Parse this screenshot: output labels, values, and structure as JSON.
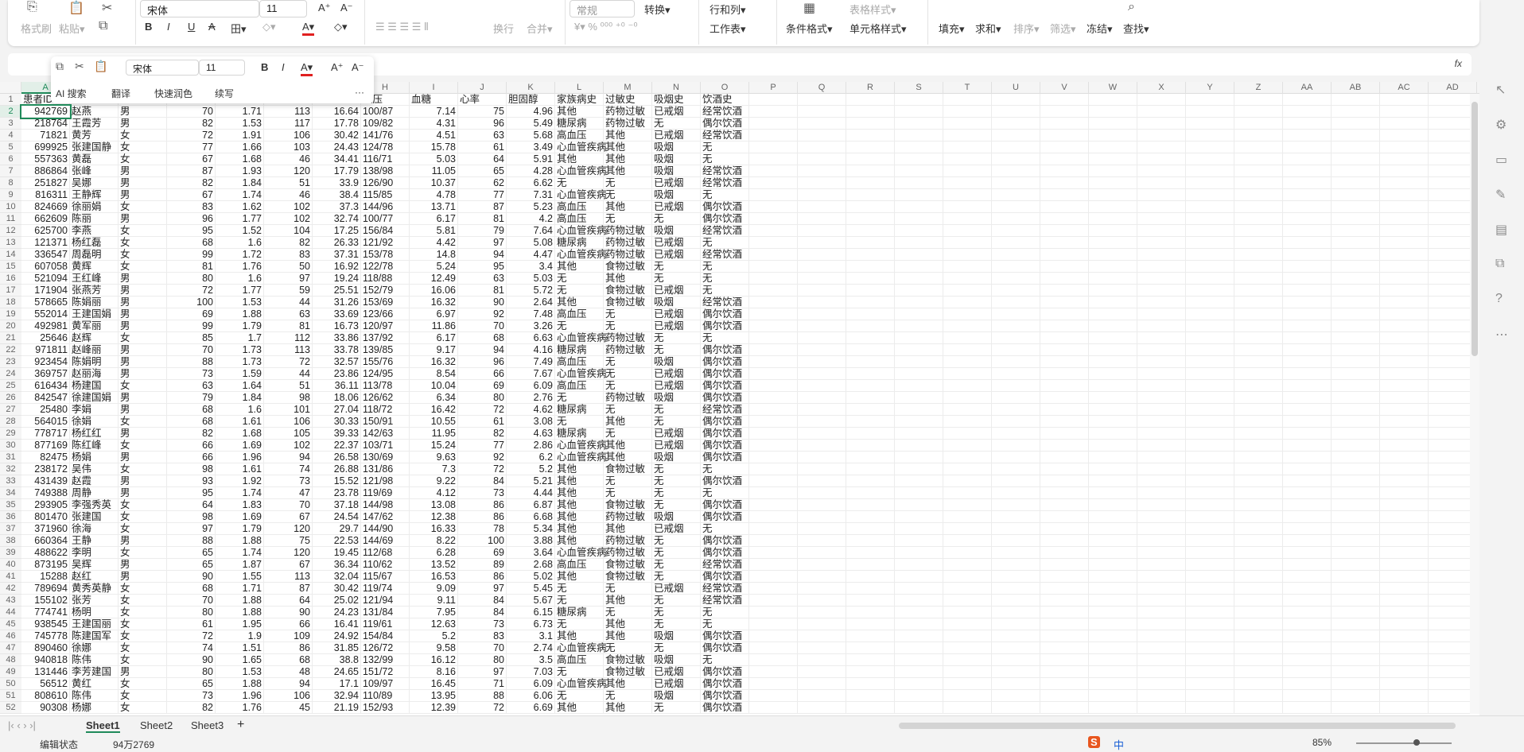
{
  "ribbon": {
    "row2": [
      "格式刷",
      "粘贴▾"
    ],
    "font": "宋体",
    "size": "11",
    "wrap": "换行",
    "merge": "合并▾",
    "number_format": "常规",
    "convert": "转换▾",
    "rows_cols": "行和列▾",
    "worksheet": "工作表▾",
    "cond_format": "条件格式▾",
    "table_style": "表格样式▾",
    "cell_style": "单元格样式▾",
    "fill": "填充▾",
    "sum": "求和▾",
    "sort": "排序▾",
    "filter": "筛选▾",
    "freeze": "冻结▾",
    "find": "查找▾",
    "accent": "#e02020"
  },
  "formula_bar": {
    "fx": "fx"
  },
  "mini_toolbar": {
    "font": "宋体",
    "size": "11",
    "ai_search": "AI 搜索",
    "translate": "翻译",
    "polish": "快速润色",
    "continue": "续写",
    "more": "···"
  },
  "columns": [
    "A",
    "B",
    "C",
    "D",
    "E",
    "F",
    "G",
    "H",
    "I",
    "J",
    "K",
    "L",
    "M",
    "N",
    "O",
    "P",
    "Q",
    "R",
    "S",
    "T",
    "U",
    "V",
    "W",
    "X",
    "Y",
    "Z",
    "AA",
    "AB",
    "AC",
    "AD"
  ],
  "header_row": [
    "患者ID",
    "",
    "",
    "",
    "",
    "",
    "",
    "血压",
    "血糖",
    "心率",
    "胆固醇",
    "家族病史",
    "过敏史",
    "吸烟史",
    "饮酒史"
  ],
  "rows": [
    [
      "942769",
      "赵燕",
      "男",
      "70",
      "1.71",
      "113",
      "16.64",
      "100/87",
      "7.14",
      "75",
      "4.96",
      "其他",
      "药物过敏",
      "已戒烟",
      "经常饮酒"
    ],
    [
      "218764",
      "王霞芳",
      "男",
      "82",
      "1.53",
      "117",
      "17.78",
      "109/82",
      "4.31",
      "96",
      "5.49",
      "糖尿病",
      "药物过敏",
      "无",
      "偶尔饮酒"
    ],
    [
      "71821",
      "黄芳",
      "女",
      "72",
      "1.91",
      "106",
      "30.42",
      "141/76",
      "4.51",
      "63",
      "5.68",
      "高血压",
      "其他",
      "已戒烟",
      "经常饮酒"
    ],
    [
      "699925",
      "张建国静",
      "女",
      "77",
      "1.66",
      "103",
      "24.43",
      "124/78",
      "15.78",
      "61",
      "3.49",
      "心血管疾病",
      "其他",
      "吸烟",
      "无"
    ],
    [
      "557363",
      "黄磊",
      "女",
      "67",
      "1.68",
      "46",
      "34.41",
      "116/71",
      "5.03",
      "64",
      "5.91",
      "其他",
      "其他",
      "吸烟",
      "无"
    ],
    [
      "886864",
      "张峰",
      "男",
      "87",
      "1.93",
      "120",
      "17.79",
      "138/98",
      "11.05",
      "65",
      "4.28",
      "心血管疾病",
      "其他",
      "吸烟",
      "经常饮酒"
    ],
    [
      "251827",
      "吴娜",
      "男",
      "82",
      "1.84",
      "51",
      "33.9",
      "126/90",
      "10.37",
      "62",
      "6.62",
      "无",
      "无",
      "已戒烟",
      "经常饮酒"
    ],
    [
      "816311",
      "王静辉",
      "男",
      "67",
      "1.74",
      "46",
      "38.4",
      "115/85",
      "4.78",
      "77",
      "7.31",
      "心血管疾病",
      "无",
      "吸烟",
      "无"
    ],
    [
      "824669",
      "徐丽娟",
      "女",
      "83",
      "1.62",
      "102",
      "37.3",
      "144/96",
      "13.71",
      "87",
      "5.23",
      "高血压",
      "其他",
      "已戒烟",
      "偶尔饮酒"
    ],
    [
      "662609",
      "陈丽",
      "男",
      "96",
      "1.77",
      "102",
      "32.74",
      "100/77",
      "6.17",
      "81",
      "4.2",
      "高血压",
      "无",
      "无",
      "偶尔饮酒"
    ],
    [
      "625700",
      "李燕",
      "女",
      "95",
      "1.52",
      "104",
      "17.25",
      "156/84",
      "5.81",
      "79",
      "7.64",
      "心血管疾病",
      "药物过敏",
      "吸烟",
      "经常饮酒"
    ],
    [
      "121371",
      "杨红磊",
      "女",
      "68",
      "1.6",
      "82",
      "26.33",
      "121/92",
      "4.42",
      "97",
      "5.08",
      "糖尿病",
      "药物过敏",
      "已戒烟",
      "无"
    ],
    [
      "336547",
      "周磊明",
      "女",
      "99",
      "1.72",
      "83",
      "37.31",
      "153/78",
      "14.8",
      "94",
      "4.47",
      "心血管疾病",
      "药物过敏",
      "已戒烟",
      "经常饮酒"
    ],
    [
      "607058",
      "黄辉",
      "女",
      "81",
      "1.76",
      "50",
      "16.92",
      "122/78",
      "5.24",
      "95",
      "3.4",
      "其他",
      "食物过敏",
      "无",
      "无"
    ],
    [
      "521094",
      "王红峰",
      "男",
      "80",
      "1.6",
      "97",
      "19.24",
      "118/88",
      "12.49",
      "63",
      "5.03",
      "无",
      "其他",
      "无",
      "无"
    ],
    [
      "171904",
      "张燕芳",
      "男",
      "72",
      "1.77",
      "59",
      "25.51",
      "152/79",
      "16.06",
      "81",
      "5.72",
      "无",
      "食物过敏",
      "已戒烟",
      "无"
    ],
    [
      "578665",
      "陈娟丽",
      "男",
      "100",
      "1.53",
      "44",
      "31.26",
      "153/69",
      "16.32",
      "90",
      "2.64",
      "其他",
      "食物过敏",
      "吸烟",
      "经常饮酒"
    ],
    [
      "552014",
      "王建国娟",
      "男",
      "69",
      "1.88",
      "63",
      "33.69",
      "123/66",
      "6.97",
      "92",
      "7.48",
      "高血压",
      "无",
      "已戒烟",
      "偶尔饮酒"
    ],
    [
      "492981",
      "黄军丽",
      "男",
      "99",
      "1.79",
      "81",
      "16.73",
      "120/97",
      "11.86",
      "70",
      "3.26",
      "无",
      "无",
      "已戒烟",
      "偶尔饮酒"
    ],
    [
      "25646",
      "赵辉",
      "女",
      "85",
      "1.7",
      "112",
      "33.86",
      "137/92",
      "6.17",
      "68",
      "6.63",
      "心血管疾病",
      "药物过敏",
      "无",
      "无"
    ],
    [
      "971811",
      "赵峰丽",
      "男",
      "70",
      "1.73",
      "113",
      "33.78",
      "139/85",
      "9.17",
      "94",
      "4.16",
      "糖尿病",
      "药物过敏",
      "无",
      "偶尔饮酒"
    ],
    [
      "923454",
      "陈娟明",
      "男",
      "88",
      "1.73",
      "72",
      "32.57",
      "155/76",
      "16.32",
      "96",
      "7.49",
      "高血压",
      "无",
      "吸烟",
      "偶尔饮酒"
    ],
    [
      "369757",
      "赵丽海",
      "男",
      "73",
      "1.59",
      "44",
      "23.86",
      "124/95",
      "8.54",
      "66",
      "7.67",
      "心血管疾病",
      "无",
      "已戒烟",
      "偶尔饮酒"
    ],
    [
      "616434",
      "杨建国",
      "女",
      "63",
      "1.64",
      "51",
      "36.11",
      "113/78",
      "10.04",
      "69",
      "6.09",
      "高血压",
      "无",
      "已戒烟",
      "偶尔饮酒"
    ],
    [
      "842547",
      "徐建国娟",
      "男",
      "79",
      "1.84",
      "98",
      "18.06",
      "126/62",
      "6.34",
      "80",
      "2.76",
      "无",
      "药物过敏",
      "吸烟",
      "偶尔饮酒"
    ],
    [
      "25480",
      "李娟",
      "男",
      "68",
      "1.6",
      "101",
      "27.04",
      "118/72",
      "16.42",
      "72",
      "4.62",
      "糖尿病",
      "无",
      "无",
      "经常饮酒"
    ],
    [
      "564015",
      "徐娟",
      "女",
      "68",
      "1.61",
      "106",
      "30.33",
      "150/91",
      "10.55",
      "61",
      "3.08",
      "无",
      "其他",
      "无",
      "偶尔饮酒"
    ],
    [
      "778717",
      "杨红红",
      "男",
      "82",
      "1.68",
      "105",
      "39.33",
      "142/63",
      "11.95",
      "82",
      "4.63",
      "糖尿病",
      "无",
      "已戒烟",
      "偶尔饮酒"
    ],
    [
      "877169",
      "陈红峰",
      "女",
      "66",
      "1.69",
      "102",
      "22.37",
      "103/71",
      "15.24",
      "77",
      "2.86",
      "心血管疾病",
      "其他",
      "已戒烟",
      "偶尔饮酒"
    ],
    [
      "82475",
      "杨娟",
      "男",
      "66",
      "1.96",
      "94",
      "26.58",
      "130/69",
      "9.63",
      "92",
      "6.2",
      "心血管疾病",
      "其他",
      "吸烟",
      "偶尔饮酒"
    ],
    [
      "238172",
      "吴伟",
      "女",
      "98",
      "1.61",
      "74",
      "26.88",
      "131/86",
      "7.3",
      "72",
      "5.2",
      "其他",
      "食物过敏",
      "无",
      "无"
    ],
    [
      "431439",
      "赵霞",
      "男",
      "93",
      "1.92",
      "73",
      "15.52",
      "121/98",
      "9.22",
      "84",
      "5.21",
      "其他",
      "无",
      "无",
      "偶尔饮酒"
    ],
    [
      "749388",
      "周静",
      "男",
      "95",
      "1.74",
      "47",
      "23.78",
      "119/69",
      "4.12",
      "73",
      "4.44",
      "其他",
      "无",
      "无",
      "无"
    ],
    [
      "293905",
      "李强秀英",
      "女",
      "64",
      "1.83",
      "70",
      "37.18",
      "144/98",
      "13.08",
      "86",
      "6.87",
      "其他",
      "食物过敏",
      "无",
      "偶尔饮酒"
    ],
    [
      "801470",
      "张建国",
      "女",
      "98",
      "1.69",
      "67",
      "24.54",
      "147/62",
      "12.38",
      "86",
      "6.68",
      "其他",
      "药物过敏",
      "吸烟",
      "偶尔饮酒"
    ],
    [
      "371960",
      "徐海",
      "女",
      "97",
      "1.79",
      "120",
      "29.7",
      "144/90",
      "16.33",
      "78",
      "5.34",
      "其他",
      "其他",
      "已戒烟",
      "无"
    ],
    [
      "660364",
      "王静",
      "男",
      "88",
      "1.88",
      "75",
      "22.53",
      "144/69",
      "8.22",
      "100",
      "3.88",
      "其他",
      "药物过敏",
      "无",
      "偶尔饮酒"
    ],
    [
      "488622",
      "李明",
      "女",
      "65",
      "1.74",
      "120",
      "19.45",
      "112/68",
      "6.28",
      "69",
      "3.64",
      "心血管疾病",
      "药物过敏",
      "无",
      "偶尔饮酒"
    ],
    [
      "873195",
      "吴辉",
      "男",
      "65",
      "1.87",
      "67",
      "36.34",
      "110/62",
      "13.52",
      "89",
      "2.68",
      "高血压",
      "食物过敏",
      "无",
      "经常饮酒"
    ],
    [
      "15288",
      "赵红",
      "男",
      "90",
      "1.55",
      "113",
      "32.04",
      "115/67",
      "16.53",
      "86",
      "5.02",
      "其他",
      "食物过敏",
      "无",
      "偶尔饮酒"
    ],
    [
      "789694",
      "黄秀英静",
      "女",
      "68",
      "1.71",
      "87",
      "30.42",
      "119/74",
      "9.09",
      "97",
      "5.45",
      "无",
      "无",
      "已戒烟",
      "经常饮酒"
    ],
    [
      "155102",
      "张芳",
      "女",
      "70",
      "1.88",
      "64",
      "25.02",
      "121/94",
      "9.11",
      "84",
      "5.67",
      "无",
      "其他",
      "无",
      "经常饮酒"
    ],
    [
      "774741",
      "杨明",
      "女",
      "80",
      "1.88",
      "90",
      "24.23",
      "131/84",
      "7.95",
      "84",
      "6.15",
      "糖尿病",
      "无",
      "无",
      "无"
    ],
    [
      "938545",
      "王建国丽",
      "女",
      "61",
      "1.95",
      "66",
      "16.41",
      "119/61",
      "12.63",
      "73",
      "6.73",
      "无",
      "其他",
      "无",
      "无"
    ],
    [
      "745778",
      "陈建国军",
      "女",
      "72",
      "1.9",
      "109",
      "24.92",
      "154/84",
      "5.2",
      "83",
      "3.1",
      "其他",
      "其他",
      "吸烟",
      "偶尔饮酒"
    ],
    [
      "890460",
      "徐娜",
      "女",
      "74",
      "1.51",
      "86",
      "31.85",
      "126/72",
      "9.58",
      "70",
      "2.74",
      "心血管疾病",
      "无",
      "无",
      "偶尔饮酒"
    ],
    [
      "940818",
      "陈伟",
      "女",
      "90",
      "1.65",
      "68",
      "38.8",
      "132/99",
      "16.12",
      "80",
      "3.5",
      "高血压",
      "食物过敏",
      "吸烟",
      "无"
    ],
    [
      "131446",
      "李芳建国",
      "男",
      "80",
      "1.53",
      "48",
      "24.65",
      "151/72",
      "8.16",
      "97",
      "7.03",
      "无",
      "食物过敏",
      "已戒烟",
      "偶尔饮酒"
    ],
    [
      "56512",
      "黄红",
      "女",
      "65",
      "1.88",
      "94",
      "17.1",
      "109/97",
      "16.45",
      "71",
      "6.09",
      "心血管疾病",
      "其他",
      "已戒烟",
      "偶尔饮酒"
    ],
    [
      "808610",
      "陈伟",
      "女",
      "73",
      "1.96",
      "106",
      "32.94",
      "110/89",
      "13.95",
      "88",
      "6.06",
      "无",
      "无",
      "吸烟",
      "偶尔饮酒"
    ],
    [
      "90308",
      "杨娜",
      "女",
      "82",
      "1.76",
      "45",
      "21.19",
      "152/93",
      "12.39",
      "72",
      "6.69",
      "其他",
      "其他",
      "无",
      "偶尔饮酒"
    ]
  ],
  "sheet_tabs": [
    "Sheet1",
    "Sheet2",
    "Sheet3"
  ],
  "add_sheet": "+",
  "status": {
    "mode": "编辑状态",
    "value": "94万2769",
    "ime": "中",
    "zoom": "85%"
  }
}
